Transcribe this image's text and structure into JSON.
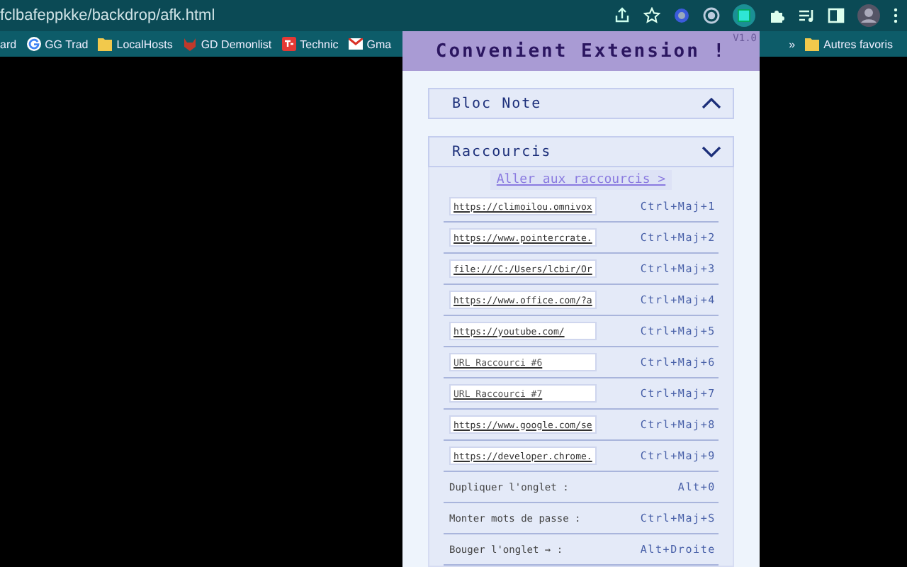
{
  "address_bar": {
    "url": "fclbafeppkke/backdrop/afk.html"
  },
  "bookmarks": [
    {
      "label": "ard"
    },
    {
      "label": "GG Trad"
    },
    {
      "label": "LocalHosts"
    },
    {
      "label": "GD Demonlist"
    },
    {
      "label": "Technic"
    },
    {
      "label": "Gma"
    }
  ],
  "bookmarks_more": "»",
  "other_bookmarks": "Autres favoris",
  "popup": {
    "title": "Convenient Extension !",
    "version": "V1.0",
    "sections": [
      {
        "title": "Bloc Note",
        "expanded": false
      },
      {
        "title": "Raccourcis",
        "expanded": true
      }
    ],
    "shortcuts_link": "Aller aux raccourcis >",
    "url_shortcuts": [
      {
        "value": "https://climoilou.omnivox",
        "keys": "Ctrl+Maj+1"
      },
      {
        "value": "https://www.pointercrate.",
        "keys": "Ctrl+Maj+2"
      },
      {
        "value": "file:///C:/Users/lcbir/Or",
        "keys": "Ctrl+Maj+3"
      },
      {
        "value": "https://www.office.com/?a",
        "keys": "Ctrl+Maj+4"
      },
      {
        "value": "https://youtube.com/",
        "keys": "Ctrl+Maj+5"
      },
      {
        "placeholder": "URL Raccourci #6",
        "keys": "Ctrl+Maj+6"
      },
      {
        "placeholder": "URL Raccourci #7",
        "keys": "Ctrl+Maj+7"
      },
      {
        "value": "https://www.google.com/se",
        "keys": "Ctrl+Maj+8"
      },
      {
        "value": "https://developer.chrome.",
        "keys": "Ctrl+Maj+9"
      }
    ],
    "action_shortcuts": [
      {
        "label": "Dupliquer l'onglet :",
        "keys": "Alt+0"
      },
      {
        "label": "Monter mots de passe :",
        "keys": "Ctrl+Maj+S"
      },
      {
        "label": "Bouger l'onglet → :",
        "keys": "Alt+Droite"
      }
    ]
  }
}
